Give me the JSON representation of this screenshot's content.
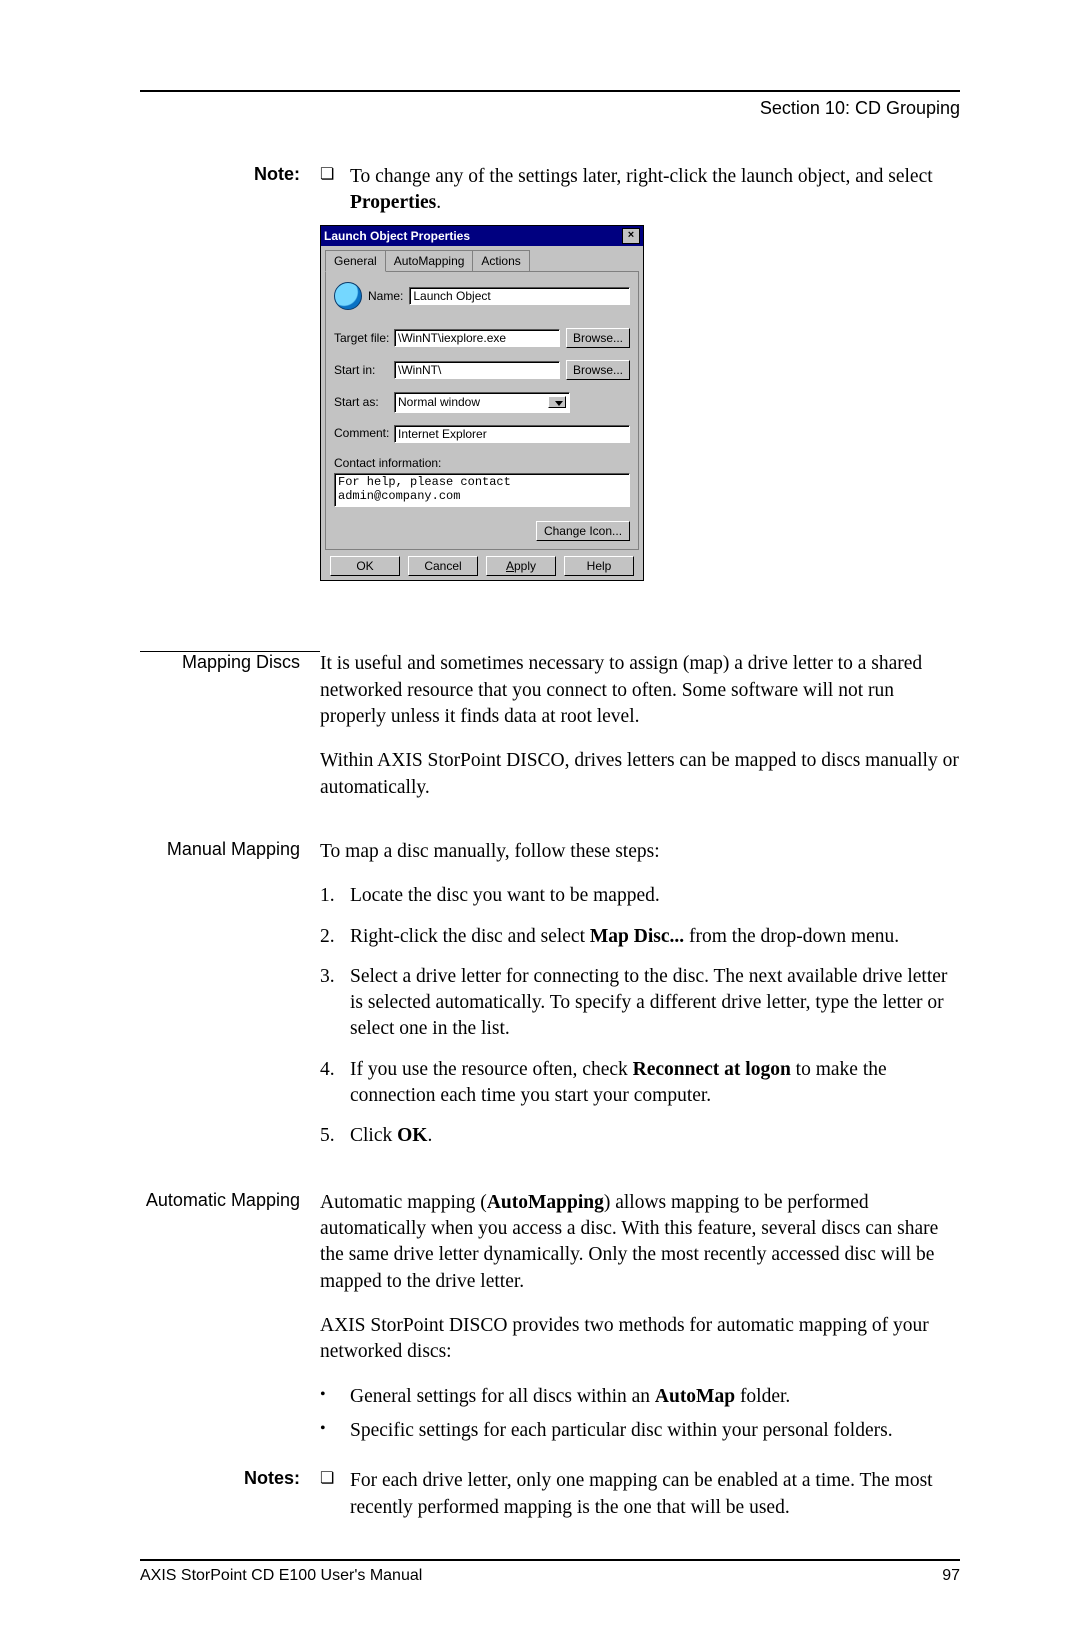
{
  "header": {
    "section_title": "Section 10: CD Grouping"
  },
  "note_block": {
    "label": "Note:",
    "text_pre": "To change any of the settings later, right-click the launch object, and select ",
    "text_bold": "Properties",
    "text_post": "."
  },
  "dialog": {
    "title": "Launch Object Properties",
    "tabs": {
      "general": "General",
      "automapping": "AutoMapping",
      "actions": "Actions"
    },
    "name_label": "Name:",
    "name_value": "Launch Object",
    "target_label": "Target file:",
    "target_value": "\\WinNT\\iexplore.exe",
    "startin_label": "Start in:",
    "startin_value": "\\WinNT\\",
    "startas_label": "Start as:",
    "startas_value": "Normal window",
    "comment_label": "Comment:",
    "comment_value": "Internet Explorer",
    "contact_label": "Contact information:",
    "contact_value": "For help, please contact admin@company.com",
    "browse": "Browse...",
    "change_icon": "Change Icon...",
    "buttons": {
      "ok": "OK",
      "cancel": "Cancel",
      "apply": "Apply",
      "help": "Help"
    }
  },
  "mapping_discs": {
    "label": "Mapping Discs",
    "p1": "It is useful and sometimes necessary to assign (map) a drive letter to a shared networked resource that you connect to often. Some software will not run properly unless it finds data at root level.",
    "p2": "Within AXIS StorPoint DISCO, drives letters can be mapped to discs manually or automatically."
  },
  "manual_mapping": {
    "label": "Manual Mapping",
    "intro": "To map a disc manually, follow these steps:",
    "steps": {
      "n1": "1.",
      "t1": "Locate the disc you want to be mapped.",
      "n2": "2.",
      "t2_pre": "Right-click the disc and select ",
      "t2_bold": "Map Disc...",
      "t2_post": " from the drop-down menu.",
      "n3": "3.",
      "t3": "Select a drive letter for connecting to the disc. The next available drive letter is selected automatically. To specify a different drive letter, type the letter or select one in the list.",
      "n4": "4.",
      "t4_pre": "If you use the resource often, check ",
      "t4_bold": "Reconnect at logon",
      "t4_post": " to make the connection each time you start your computer.",
      "n5": "5.",
      "t5_pre": "Click ",
      "t5_bold": "OK",
      "t5_post": "."
    }
  },
  "auto_mapping": {
    "label": "Automatic Mapping",
    "p1_pre": "Automatic mapping (",
    "p1_bold": "AutoMapping",
    "p1_post": ") allows mapping to be performed automatically when you access a disc. With this feature, several discs can share the same drive letter dynamically. Only the most recently accessed disc will be mapped to the drive letter.",
    "p2": "AXIS StorPoint DISCO provides two methods for automatic mapping of your networked discs:",
    "b1_pre": "General settings for all discs within an ",
    "b1_bold": "AutoMap",
    "b1_post": " folder.",
    "b2": "Specific settings for each particular disc within your personal folders."
  },
  "notes_block": {
    "label": "Notes:",
    "n1": "For each drive letter, only one mapping can be enabled at a time. The most recently performed mapping is the one that will be used."
  },
  "footer": {
    "left": "AXIS StorPoint CD E100 User's Manual",
    "right": "97"
  }
}
